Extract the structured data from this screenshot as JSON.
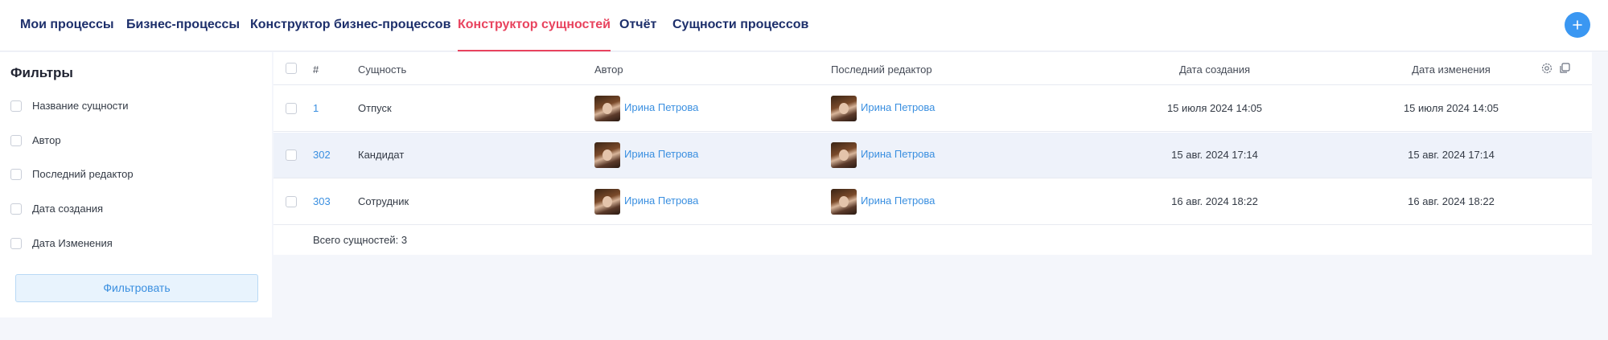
{
  "nav": {
    "tabs": [
      {
        "label": "Мои процессы"
      },
      {
        "label": "Бизнес-процессы"
      },
      {
        "label": "Конструктор бизнес-процессов"
      },
      {
        "label": "Конструктор сущностей",
        "active": true
      },
      {
        "label": "Отчёт"
      },
      {
        "label": "Сущности процессов"
      }
    ],
    "add_icon": "plus-icon"
  },
  "filters": {
    "title": "Фильтры",
    "items": [
      {
        "label": "Название сущности"
      },
      {
        "label": "Автор"
      },
      {
        "label": "Последний редактор"
      },
      {
        "label": "Дата создания"
      },
      {
        "label": "Дата Изменения"
      }
    ],
    "button_label": "Фильтровать"
  },
  "table": {
    "columns": {
      "num": "#",
      "entity": "Сущность",
      "author": "Автор",
      "editor": "Последний редактор",
      "created": "Дата создания",
      "modified": "Дата изменения"
    },
    "header_icons": [
      "gear-icon",
      "copy-icon"
    ],
    "rows": [
      {
        "num": "1",
        "entity": "Отпуск",
        "author": "Ирина Петрова",
        "editor": "Ирина Петрова",
        "created": "15 июля 2024 14:05",
        "modified": "15 июля 2024 14:05"
      },
      {
        "num": "302",
        "entity": "Кандидат",
        "author": "Ирина Петрова",
        "editor": "Ирина Петрова",
        "created": "15 авг. 2024 17:14",
        "modified": "15 авг. 2024 17:14"
      },
      {
        "num": "303",
        "entity": "Сотрудник",
        "author": "Ирина Петрова",
        "editor": "Ирина Петрова",
        "created": "16 авг. 2024 18:22",
        "modified": "16 авг. 2024 18:22"
      }
    ],
    "total_text": "Всего сущностей: 3"
  },
  "colors": {
    "accent": "#e8435e",
    "nav_text": "#1d2f6b",
    "link": "#3a8fe0",
    "add_button": "#3a97f2",
    "highlight_row": "#eef2fa"
  }
}
